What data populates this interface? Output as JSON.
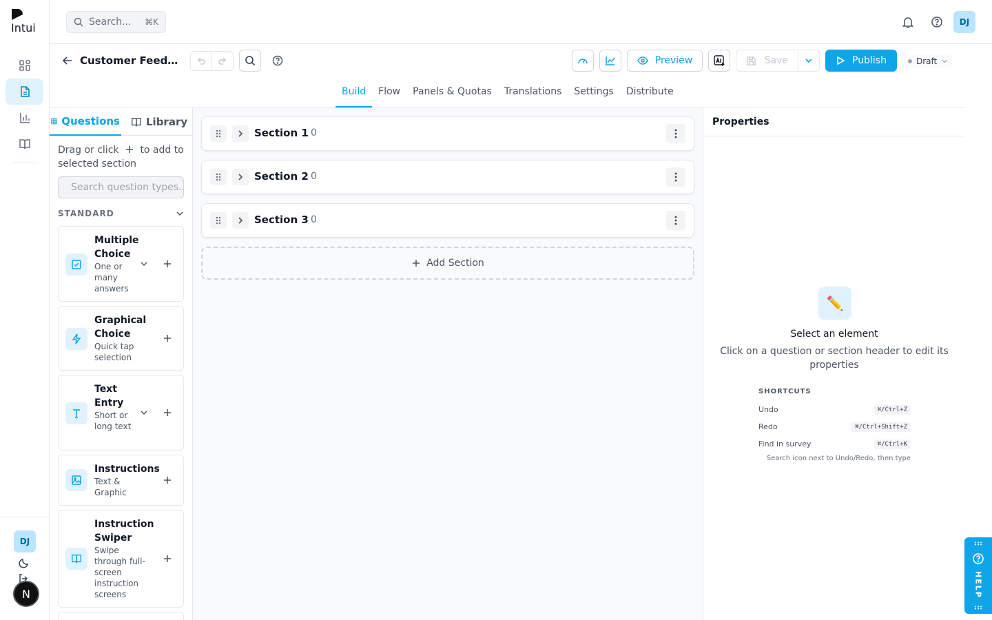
{
  "app": {
    "brand": "Intui",
    "user_initials": "DJ",
    "corner_badge": "N"
  },
  "topbar": {
    "search_placeholder": "Search...",
    "search_shortcut": "⌘K"
  },
  "survey": {
    "title": "Customer Feedback Survey",
    "status": "Draft"
  },
  "toolbar": {
    "preview_label": "Preview",
    "save_label": "Save",
    "publish_label": "Publish"
  },
  "tabs": [
    "Build",
    "Flow",
    "Panels & Quotas",
    "Translations",
    "Settings",
    "Distribute"
  ],
  "active_tab": "Build",
  "questions_panel": {
    "tabs": [
      "Questions",
      "Library"
    ],
    "hint_prefix": "Drag or click",
    "hint_suffix": "to add to selected section",
    "search_placeholder": "Search question types...",
    "group_label": "STANDARD",
    "items": [
      {
        "title": "Multiple Choice",
        "desc": "One or many answers",
        "icon": "checkbox-icon"
      },
      {
        "title": "Graphical Choice",
        "desc": "Quick tap selection",
        "icon": "lightning-icon"
      },
      {
        "title": "Text Entry",
        "desc": "Short or long text",
        "icon": "text-icon"
      },
      {
        "title": "Instructions",
        "desc": "Text & Graphic",
        "icon": "image-icon"
      },
      {
        "title": "Instruction Swiper",
        "desc": "Swipe through full-screen instruction screens",
        "icon": "book-icon"
      }
    ]
  },
  "sections": [
    {
      "name": "Section 1",
      "count": "0"
    },
    {
      "name": "Section 2",
      "count": "0"
    },
    {
      "name": "Section 3",
      "count": "0"
    }
  ],
  "add_section_label": "Add Section",
  "properties": {
    "title": "Properties",
    "empty_icon": "✏️",
    "empty_title": "Select an element",
    "empty_desc": "Click on a question or section header to edit its properties",
    "shortcuts_title": "SHORTCUTS",
    "shortcuts": [
      {
        "label": "Undo",
        "key": "⌘/Ctrl+Z"
      },
      {
        "label": "Redo",
        "key": "⌘/Ctrl+Shift+Z"
      },
      {
        "label": "Find in survey",
        "key": "⌘/Ctrl+K"
      }
    ],
    "shortcut_note": "Search icon next to Undo/Redo, then type"
  },
  "help_tab_label": "HELP",
  "colors": {
    "accent": "#0ea5e9",
    "accent_light": "#e0f2fe"
  }
}
